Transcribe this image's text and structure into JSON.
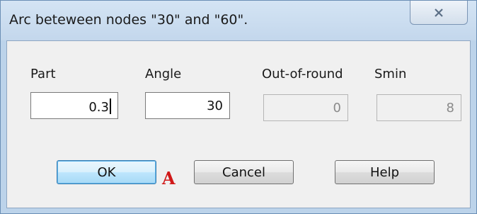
{
  "window": {
    "title": "Arc beteween nodes \"30\" and \"60\".",
    "close_icon": "close-x-icon"
  },
  "fields": {
    "part": {
      "label": "Part",
      "value": "0.3"
    },
    "angle": {
      "label": "Angle",
      "value": "30"
    },
    "out_of_round": {
      "label": "Out-of-round",
      "value": "0"
    },
    "smin": {
      "label": "Smin",
      "value": "8"
    }
  },
  "marker": {
    "text": "A",
    "color": "#d01818"
  },
  "buttons": {
    "ok": "OK",
    "cancel": "Cancel",
    "help": "Help"
  }
}
